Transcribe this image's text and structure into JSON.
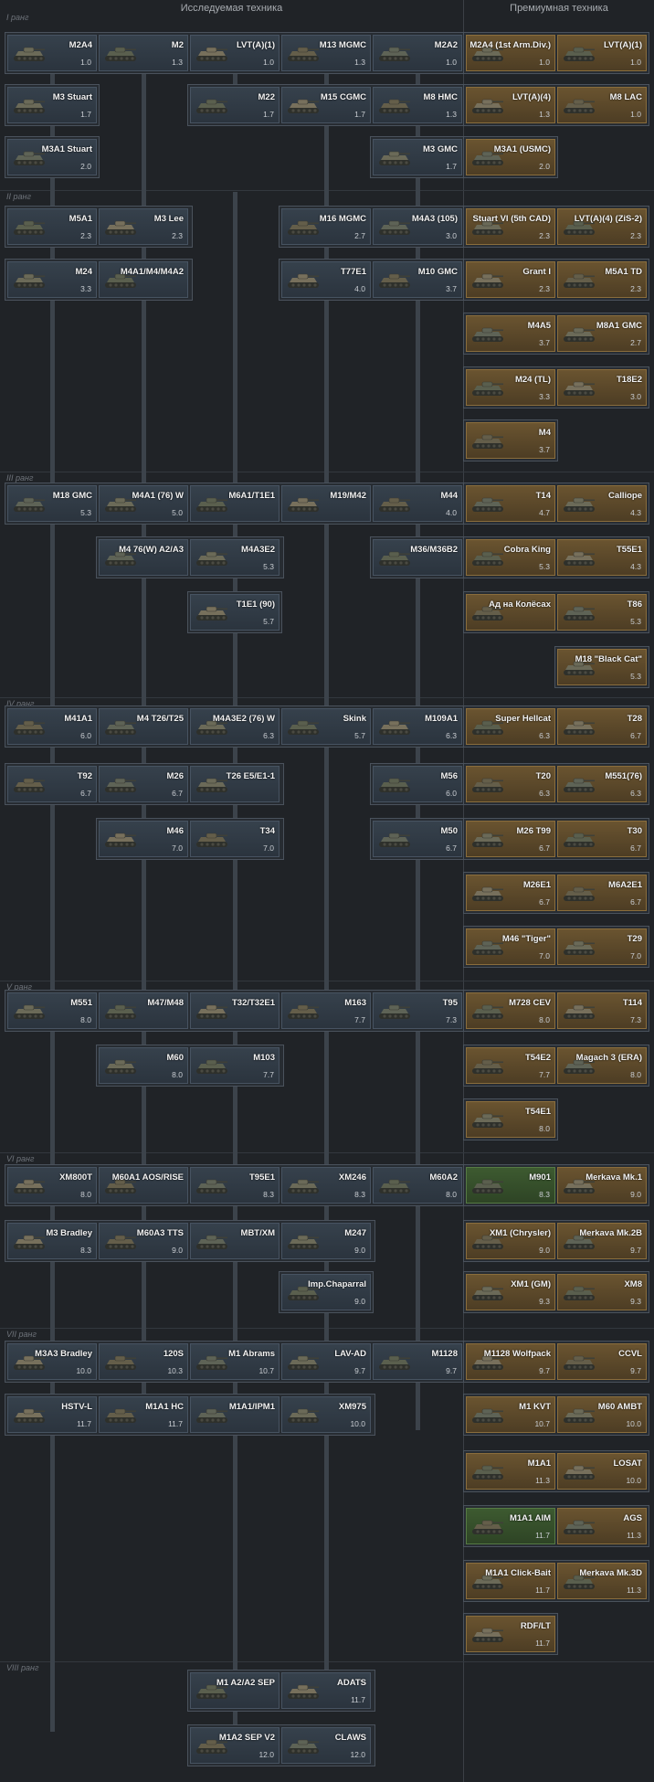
{
  "headers": {
    "researchable": "Исследуемая техника",
    "premium": "Премиумная техника"
  },
  "ranks": [
    "I ранг",
    "II ранг",
    "III ранг",
    "IV ранг",
    "V ранг",
    "VI ранг",
    "VII ранг",
    "VIII ранг"
  ],
  "researchable": [
    {
      "name": "M2A4",
      "br": "1.0"
    },
    {
      "name": "M2",
      "br": "1.3"
    },
    {
      "name": "LVT(A)(1)",
      "br": "1.0"
    },
    {
      "name": "M13 MGMC",
      "br": "1.3"
    },
    {
      "name": "M2A2",
      "br": "1.0"
    },
    {
      "name": "M3 Stuart",
      "br": "1.7"
    },
    {
      "name": "M22",
      "br": "1.7"
    },
    {
      "name": "M15 CGMC",
      "br": "1.7"
    },
    {
      "name": "M8 HMC",
      "br": "1.3"
    },
    {
      "name": "M3A1 Stuart",
      "br": "2.0"
    },
    {
      "name": "M3 GMC",
      "br": "1.7"
    },
    {
      "name": "M5A1",
      "br": "2.3"
    },
    {
      "name": "M3 Lee",
      "br": "2.3"
    },
    {
      "name": "M16 MGMC",
      "br": "2.7"
    },
    {
      "name": "M4A3 (105)",
      "br": "3.0"
    },
    {
      "name": "M24",
      "br": "3.3"
    },
    {
      "name": "M4A1/M4/M4A2",
      "br": ""
    },
    {
      "name": "T77E1",
      "br": "4.0"
    },
    {
      "name": "M10 GMC",
      "br": "3.7"
    },
    {
      "name": "M18 GMC",
      "br": "5.3"
    },
    {
      "name": "M4A1 (76) W",
      "br": "5.0"
    },
    {
      "name": "M6A1/T1E1",
      "br": ""
    },
    {
      "name": "M19/M42",
      "br": ""
    },
    {
      "name": "M44",
      "br": "4.0"
    },
    {
      "name": "M4 76(W) A2/A3",
      "br": ""
    },
    {
      "name": "M4A3E2",
      "br": "5.3"
    },
    {
      "name": "M36/M36B2",
      "br": ""
    },
    {
      "name": "T1E1 (90)",
      "br": "5.7"
    },
    {
      "name": "M41A1",
      "br": "6.0"
    },
    {
      "name": "M4 T26/T25",
      "br": ""
    },
    {
      "name": "M4A3E2 (76) W",
      "br": "6.3"
    },
    {
      "name": "Skink",
      "br": "5.7"
    },
    {
      "name": "M109A1",
      "br": "6.3"
    },
    {
      "name": "T92",
      "br": "6.7"
    },
    {
      "name": "M26",
      "br": "6.7"
    },
    {
      "name": "T26 E5/E1-1",
      "br": ""
    },
    {
      "name": "M56",
      "br": "6.0"
    },
    {
      "name": "M46",
      "br": "7.0"
    },
    {
      "name": "T34",
      "br": "7.0"
    },
    {
      "name": "M50",
      "br": "6.7"
    },
    {
      "name": "M551",
      "br": "8.0"
    },
    {
      "name": "M47/M48",
      "br": ""
    },
    {
      "name": "T32/T32E1",
      "br": ""
    },
    {
      "name": "M163",
      "br": "7.7"
    },
    {
      "name": "T95",
      "br": "7.3"
    },
    {
      "name": "M60",
      "br": "8.0"
    },
    {
      "name": "M103",
      "br": "7.7"
    },
    {
      "name": "XM800T",
      "br": "8.0"
    },
    {
      "name": "M60A1 AOS/RISE",
      "br": ""
    },
    {
      "name": "T95E1",
      "br": "8.3"
    },
    {
      "name": "XM246",
      "br": "8.3"
    },
    {
      "name": "M60A2",
      "br": "8.0"
    },
    {
      "name": "M3 Bradley",
      "br": "8.3"
    },
    {
      "name": "M60A3 TTS",
      "br": "9.0"
    },
    {
      "name": "MBT/XM",
      "br": ""
    },
    {
      "name": "M247",
      "br": "9.0"
    },
    {
      "name": "Imp.Chaparral",
      "br": "9.0"
    },
    {
      "name": "M3A3 Bradley",
      "br": "10.0"
    },
    {
      "name": "120S",
      "br": "10.3"
    },
    {
      "name": "M1 Abrams",
      "br": "10.7"
    },
    {
      "name": "LAV-AD",
      "br": "9.7"
    },
    {
      "name": "M1128",
      "br": "9.7"
    },
    {
      "name": "HSTV-L",
      "br": "11.7"
    },
    {
      "name": "M1A1 HC",
      "br": "11.7"
    },
    {
      "name": "M1A1/IPM1",
      "br": ""
    },
    {
      "name": "XM975",
      "br": "10.0"
    },
    {
      "name": "M1 A2/A2 SEP",
      "br": ""
    },
    {
      "name": "ADATS",
      "br": "11.7"
    },
    {
      "name": "M1A2 SEP V2",
      "br": "12.0"
    },
    {
      "name": "CLAWS",
      "br": "12.0"
    }
  ],
  "premium": [
    {
      "name": "M2A4 (1st Arm.Div.)",
      "br": "1.0"
    },
    {
      "name": "LVT(A)(1)",
      "br": "1.0"
    },
    {
      "name": "LVT(A)(4)",
      "br": "1.3"
    },
    {
      "name": "M8 LAC",
      "br": "1.0"
    },
    {
      "name": "M3A1 (USMC)",
      "br": "2.0"
    },
    {
      "name": "Stuart VI (5th CAD)",
      "br": "2.3"
    },
    {
      "name": "LVT(A)(4) (ZiS-2)",
      "br": "2.3"
    },
    {
      "name": "Grant I",
      "br": "2.3"
    },
    {
      "name": "M5A1 TD",
      "br": "2.3"
    },
    {
      "name": "M4A5",
      "br": "3.7"
    },
    {
      "name": "M8A1 GMC",
      "br": "2.7"
    },
    {
      "name": "M24 (TL)",
      "br": "3.3"
    },
    {
      "name": "T18E2",
      "br": "3.0"
    },
    {
      "name": "M4",
      "br": "3.7"
    },
    {
      "name": "T14",
      "br": "4.7"
    },
    {
      "name": "Calliope",
      "br": "4.3"
    },
    {
      "name": "Cobra King",
      "br": "5.3"
    },
    {
      "name": "T55E1",
      "br": "4.3"
    },
    {
      "name": "Ад на Колёсах",
      "br": ""
    },
    {
      "name": "T86",
      "br": "5.3"
    },
    {
      "name": "M18 \"Black Cat\"",
      "br": "5.3"
    },
    {
      "name": "Super Hellcat",
      "br": "6.3"
    },
    {
      "name": "T28",
      "br": "6.7"
    },
    {
      "name": "T20",
      "br": "6.3"
    },
    {
      "name": "M551(76)",
      "br": "6.3"
    },
    {
      "name": "M26 T99",
      "br": "6.7"
    },
    {
      "name": "T30",
      "br": "6.7"
    },
    {
      "name": "M26E1",
      "br": "6.7"
    },
    {
      "name": "M6A2E1",
      "br": "6.7"
    },
    {
      "name": "M46 \"Tiger\"",
      "br": "7.0"
    },
    {
      "name": "T29",
      "br": "7.0"
    },
    {
      "name": "M728 CEV",
      "br": "8.0"
    },
    {
      "name": "T114",
      "br": "7.3"
    },
    {
      "name": "T54E2",
      "br": "7.7"
    },
    {
      "name": "Magach 3 (ERA)",
      "br": "8.0"
    },
    {
      "name": "T54E1",
      "br": "8.0"
    },
    {
      "name": "M901",
      "br": "8.3"
    },
    {
      "name": "Merkava Mk.1",
      "br": "9.0"
    },
    {
      "name": "XM1 (Chrysler)",
      "br": "9.0"
    },
    {
      "name": "Merkava Mk.2B",
      "br": "9.7"
    },
    {
      "name": "XM1 (GM)",
      "br": "9.3"
    },
    {
      "name": "XM8",
      "br": "9.3"
    },
    {
      "name": "M1128 Wolfpack",
      "br": "9.7"
    },
    {
      "name": "CCVL",
      "br": "9.7"
    },
    {
      "name": "M1 KVT",
      "br": "10.7"
    },
    {
      "name": "M60 AMBT",
      "br": "10.0"
    },
    {
      "name": "M1A1",
      "br": "11.3"
    },
    {
      "name": "LOSAT",
      "br": "10.0"
    },
    {
      "name": "M1A1 AIM",
      "br": "11.7"
    },
    {
      "name": "AGS",
      "br": "11.3"
    },
    {
      "name": "M1A1 Click-Bait",
      "br": "11.7"
    },
    {
      "name": "Merkava Mk.3D",
      "br": "11.3"
    },
    {
      "name": "RDF/LT",
      "br": "11.7"
    }
  ]
}
